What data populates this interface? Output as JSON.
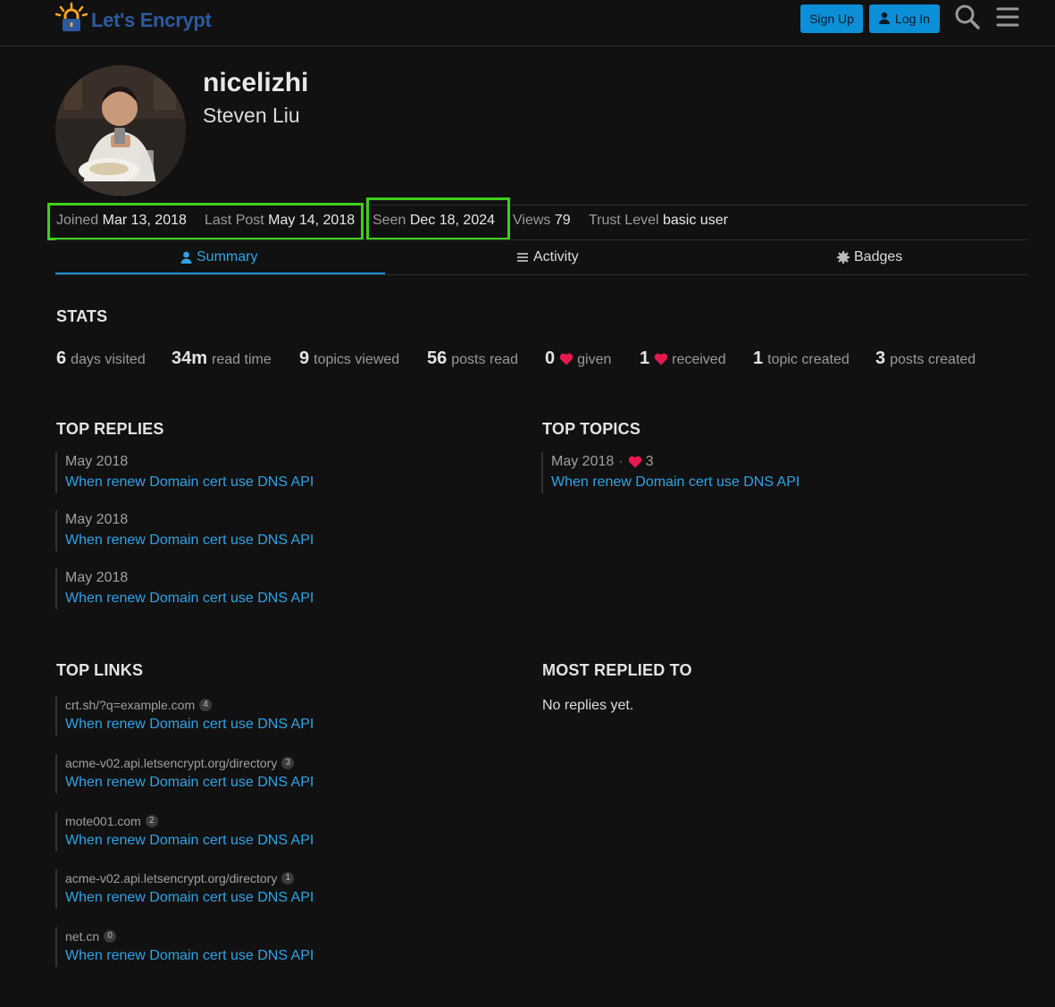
{
  "header": {
    "logo_text": "Let's Encrypt",
    "signup_label": "Sign Up",
    "login_label": "Log In",
    "accent_color": "#0b8fd6"
  },
  "profile": {
    "username": "nicelizhi",
    "full_name": "Steven Liu",
    "meta": {
      "joined_label": "Joined",
      "joined_value": "Mar 13, 2018",
      "last_post_label": "Last Post",
      "last_post_value": "May 14, 2018",
      "seen_label": "Seen",
      "seen_value": "Dec 18, 2024",
      "views_label": "Views",
      "views_value": "79",
      "trust_label": "Trust Level",
      "trust_value": "basic user"
    }
  },
  "nav": {
    "tabs": [
      {
        "label": "Summary",
        "icon": "user-icon",
        "active": true
      },
      {
        "label": "Activity",
        "icon": "list-icon"
      },
      {
        "label": "Badges",
        "icon": "badge-icon"
      }
    ]
  },
  "stats": {
    "title": "STATS",
    "items": [
      {
        "num": "6",
        "text": "days visited"
      },
      {
        "num": "34m",
        "text": "read time"
      },
      {
        "num": "9",
        "text": "topics viewed"
      },
      {
        "num": "56",
        "text": "posts read"
      },
      {
        "num": "0",
        "text": "given",
        "icon": "heart-icon"
      },
      {
        "num": "1",
        "text": "received",
        "icon": "heart-icon"
      },
      {
        "num": "1",
        "text": "topic created"
      },
      {
        "num": "3",
        "text": "posts created"
      }
    ]
  },
  "top_replies": {
    "title": "TOP REPLIES",
    "items": [
      {
        "date": "May 2018",
        "title": "When renew Domain cert use DNS API"
      },
      {
        "date": "May 2018",
        "title": "When renew Domain cert use DNS API"
      },
      {
        "date": "May 2018",
        "title": "When renew Domain cert use DNS API"
      }
    ]
  },
  "top_topics": {
    "title": "TOP TOPICS",
    "items": [
      {
        "date": "May 2018",
        "separator": "·",
        "likes": "3",
        "title": "When renew Domain cert use DNS API"
      }
    ]
  },
  "top_links": {
    "title": "TOP LINKS",
    "items": [
      {
        "url": "crt.sh/?q=example.com",
        "count": "4",
        "title": "When renew Domain cert use DNS API"
      },
      {
        "url": "acme-v02.api.letsencrypt.org/directory",
        "count": "3",
        "title": "When renew Domain cert use DNS API"
      },
      {
        "url": "mote001.com",
        "count": "2",
        "title": "When renew Domain cert use DNS API"
      },
      {
        "url": "acme-v02.api.letsencrypt.org/directory",
        "count": "1",
        "title": "When renew Domain cert use DNS API"
      },
      {
        "url": "net.cn",
        "count": "0",
        "title": "When renew Domain cert use DNS API"
      }
    ]
  },
  "most_replied_to": {
    "title": "MOST REPLIED TO",
    "empty_text": "No replies yet."
  },
  "colors": {
    "background": "#111111",
    "link": "#2fa3e6",
    "heart": "#e8174f",
    "highlight": "#3cd11a"
  }
}
